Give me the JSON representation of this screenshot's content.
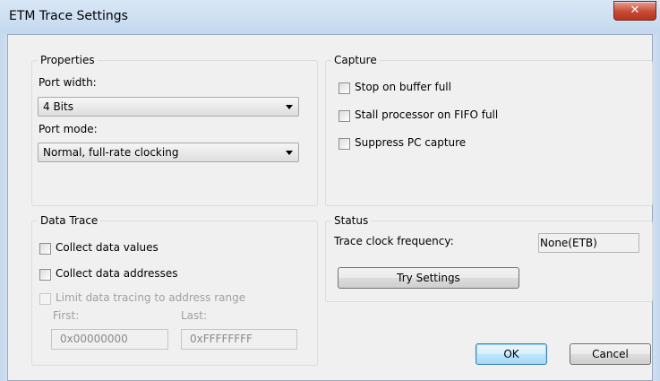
{
  "window": {
    "title": "ETM Trace Settings"
  },
  "properties": {
    "label": "Properties",
    "port_width_label": "Port width:",
    "port_width_value": "4 Bits",
    "port_mode_label": "Port mode:",
    "port_mode_value": "Normal, full-rate clocking"
  },
  "capture": {
    "label": "Capture",
    "options": [
      {
        "label": "Stop on buffer full",
        "checked": false
      },
      {
        "label": "Stall processor on FIFO full",
        "checked": false
      },
      {
        "label": "Suppress PC capture",
        "checked": false
      }
    ]
  },
  "data_trace": {
    "label": "Data Trace",
    "collect_values": "Collect data values",
    "collect_addresses": "Collect data addresses",
    "limit_range": "Limit data tracing to address range",
    "first_label": "First:",
    "last_label": "Last:",
    "first_value": "0x00000000",
    "last_value": "0xFFFFFFFF"
  },
  "status": {
    "label": "Status",
    "freq_label": "Trace clock frequency:",
    "freq_value": "None(ETB)",
    "try_button": "Try Settings"
  },
  "buttons": {
    "ok": "OK",
    "cancel": "Cancel"
  }
}
